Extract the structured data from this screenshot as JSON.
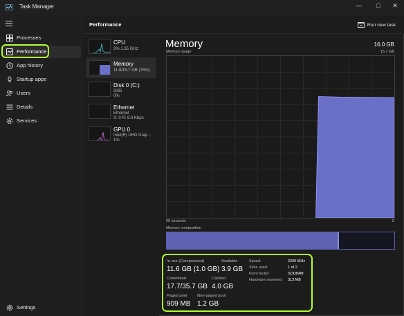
{
  "window": {
    "title": "Task Manager",
    "controls": {
      "minimize": "—",
      "maximize": "□",
      "close": "✕"
    }
  },
  "sidebar": {
    "items": [
      {
        "label": "Processes",
        "icon": "grid-icon"
      },
      {
        "label": "Performance",
        "icon": "performance-icon",
        "active": true
      },
      {
        "label": "App history",
        "icon": "history-icon"
      },
      {
        "label": "Startup apps",
        "icon": "startup-icon"
      },
      {
        "label": "Users",
        "icon": "users-icon"
      },
      {
        "label": "Details",
        "icon": "details-icon"
      },
      {
        "label": "Services",
        "icon": "services-icon"
      }
    ],
    "settings_label": "Settings"
  },
  "header": {
    "title": "Performance",
    "run_task_label": "Run new task"
  },
  "resources": [
    {
      "name": "CPU",
      "sub1": "3%  1.35 GHz",
      "sub2": "",
      "sub3": ""
    },
    {
      "name": "Memory",
      "sub1": "11.8/15.7 GB (75%)",
      "sub2": "",
      "sub3": "",
      "active": true
    },
    {
      "name": "Disk 0 (C:)",
      "sub1": "SSD",
      "sub2": "0%",
      "sub3": ""
    },
    {
      "name": "Ethernet",
      "sub1": "Ethernet",
      "sub2": "S: 0  R: 8.0 Kbps",
      "sub3": ""
    },
    {
      "name": "GPU 0",
      "sub1": "Intel(R) UHD Grap...",
      "sub2": "1%",
      "sub3": ""
    }
  ],
  "memory": {
    "title": "Memory",
    "total": "16.0 GB",
    "usage_label": "Memory usage",
    "usage_max": "15.7 GB",
    "axis_left": "60 seconds",
    "axis_right": "0",
    "composition_label": "Memory composition",
    "usage_fraction": 0.75,
    "inuse_fraction": 0.75,
    "modified_fraction": 0.008
  },
  "stats": {
    "in_use_label": "In use (Compressed)",
    "in_use_value": "11.6 GB (1.0 GB)",
    "available_label": "Available",
    "available_value": "3.9 GB",
    "committed_label": "Committed",
    "committed_value": "17.7/35.7 GB",
    "cached_label": "Cached",
    "cached_value": "4.0 GB",
    "paged_label": "Paged pool",
    "paged_value": "909 MB",
    "nonpaged_label": "Non-paged pool",
    "nonpaged_value": "1.2 GB",
    "speed_label": "Speed:",
    "speed_value": "3200 MHz",
    "slots_label": "Slots used:",
    "slots_value": "1 of 2",
    "form_label": "Form factor:",
    "form_value": "SODIMM",
    "hwres_label": "Hardware reserved:",
    "hwres_value": "313 MB"
  },
  "colors": {
    "accent_highlight": "#b2ff2e",
    "memory_fill": "#6a70c8",
    "cpu_line": "#4fc1c9",
    "gpu_line": "#c56fe0"
  }
}
